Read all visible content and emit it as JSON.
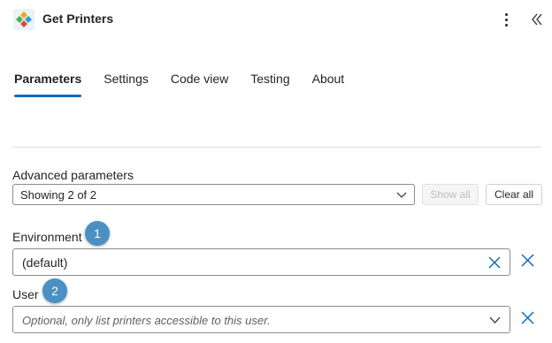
{
  "header": {
    "title": "Get Printers",
    "app_icon": "power-automate-printer-icon",
    "more_icon": "more-vertical-icon",
    "collapse_icon": "double-chevron-left-icon"
  },
  "tabs": [
    {
      "label": "Parameters",
      "active": true
    },
    {
      "label": "Settings",
      "active": false
    },
    {
      "label": "Code view",
      "active": false
    },
    {
      "label": "Testing",
      "active": false
    },
    {
      "label": "About",
      "active": false
    }
  ],
  "advanced": {
    "label": "Advanced parameters",
    "value": "Showing 2 of 2",
    "show_all": "Show all",
    "clear_all": "Clear all"
  },
  "fields": {
    "environment": {
      "label": "Environment",
      "badge": "1",
      "value": "(default)"
    },
    "user": {
      "label": "User",
      "badge": "2",
      "placeholder": "Optional, only list printers accessible to this user."
    }
  },
  "colors": {
    "accent": "#0f6cbd",
    "badge": "#4a90c2"
  }
}
